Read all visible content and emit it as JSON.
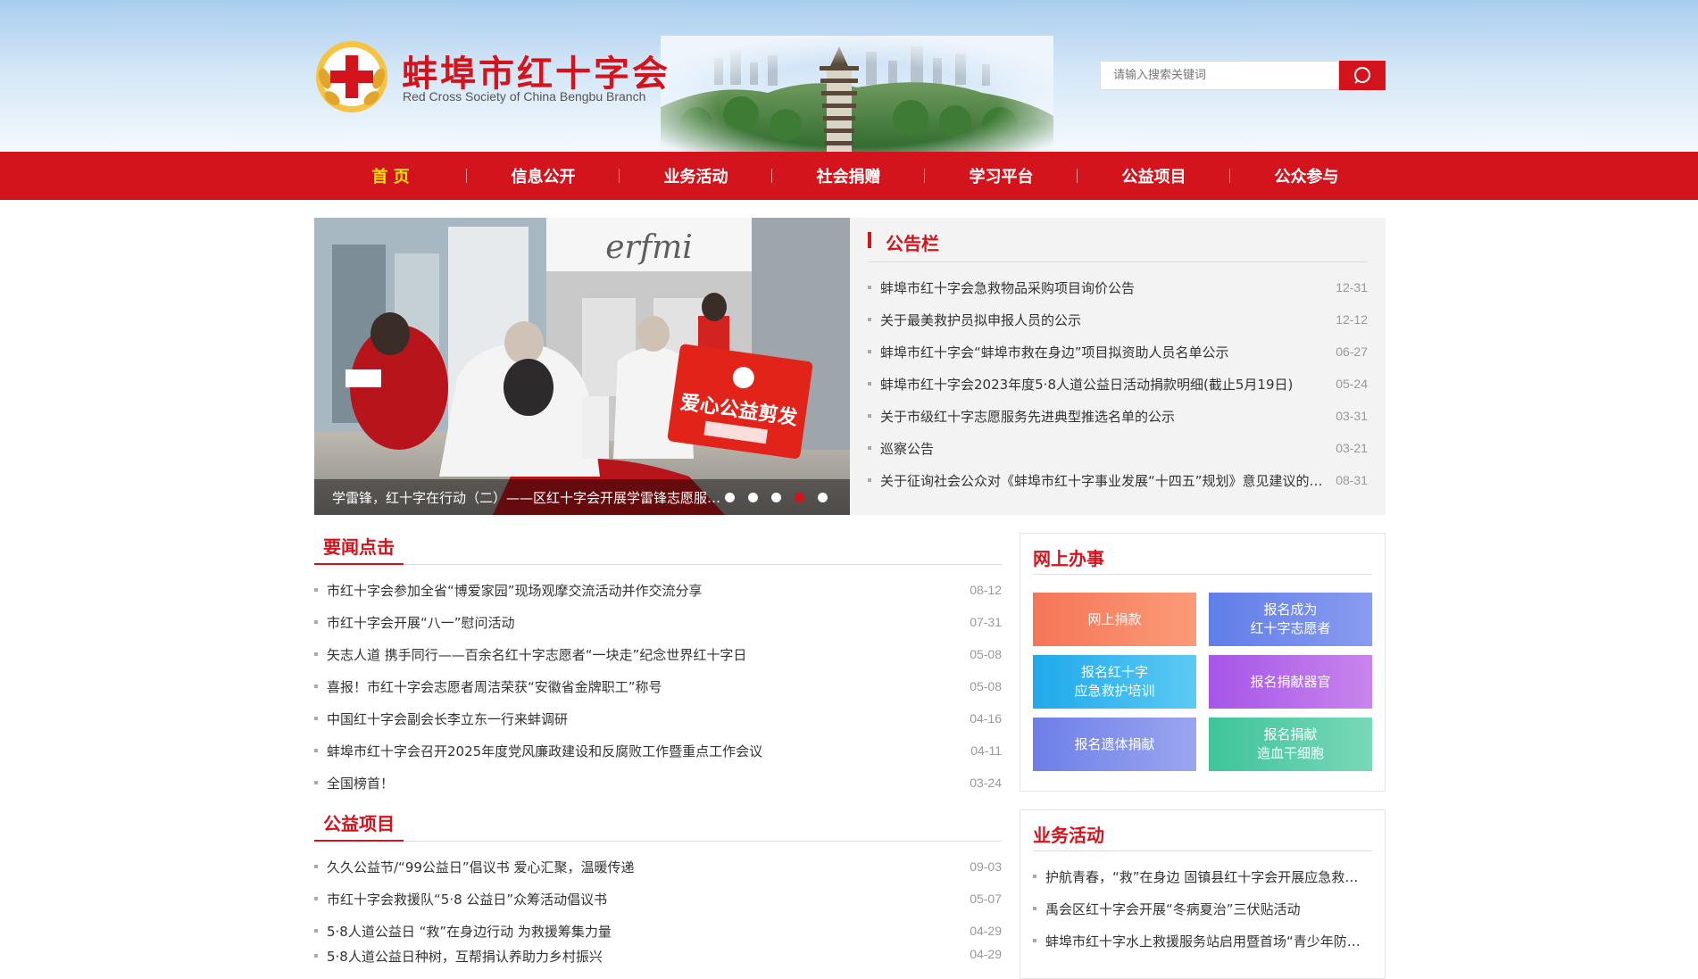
{
  "header": {
    "org_name_cn": "蚌埠市红十字会",
    "org_name_en": "Red Cross Society of China Bengbu Branch",
    "search_placeholder": "请输入搜索关键词"
  },
  "nav": {
    "items": [
      "首 页",
      "信息公开",
      "业务活动",
      "社会捐赠",
      "学习平台",
      "公益项目",
      "公众参与"
    ],
    "active": "首 页"
  },
  "slider": {
    "caption": "学雷锋，红十字在行动（二）——区红十字会开展学雷锋志愿服务活动",
    "storefront_sign": "erfmi",
    "banner_text": "爱心公益剪发",
    "active_dot": 4,
    "dot_count": 5
  },
  "notice_board": {
    "title": "公告栏",
    "items": [
      {
        "text": "蚌埠市红十字会急救物品采购项目询价公告",
        "date": "12-31"
      },
      {
        "text": "关于最美救护员拟申报人员的公示",
        "date": "12-12"
      },
      {
        "text": "蚌埠市红十字会“蚌埠市救在身边”项目拟资助人员名单公示",
        "date": "06-27"
      },
      {
        "text": "蚌埠市红十字会2023年度5·8人道公益日活动捐款明细(截止5月19日)",
        "date": "05-24"
      },
      {
        "text": "关于市级红十字志愿服务先进典型推选名单的公示",
        "date": "03-31"
      },
      {
        "text": "巡察公告",
        "date": "03-21"
      },
      {
        "text": "关于征询社会公众对《蚌埠市红十字事业发展“十四五”规划》意见建议的公告",
        "date": "08-31"
      }
    ]
  },
  "news": {
    "title": "要闻点击",
    "items": [
      {
        "text": "市红十字会参加全省“博爱家园”现场观摩交流活动并作交流分享",
        "date": "08-12"
      },
      {
        "text": "市红十字会开展“八一”慰问活动",
        "date": "07-31"
      },
      {
        "text": "矢志人道 携手同行——百余名红十字志愿者“一块走”纪念世界红十字日",
        "date": "05-08"
      },
      {
        "text": "喜报！市红十字会志愿者周洁荣获“安徽省金牌职工”称号",
        "date": "05-08"
      },
      {
        "text": "中国红十字会副会长李立东一行来蚌调研",
        "date": "04-16"
      },
      {
        "text": "蚌埠市红十字会召开2025年度党风廉政建设和反腐败工作暨重点工作会议",
        "date": "04-11"
      },
      {
        "text": "全国榜首！",
        "date": "03-24"
      }
    ]
  },
  "projects": {
    "title": "公益项目",
    "items": [
      {
        "text": "久久公益节/“99公益日”倡议书 爱心汇聚，温暖传递",
        "date": "09-03"
      },
      {
        "text": "市红十字会救援队“5·8 公益日”众筹活动倡议书",
        "date": "05-07"
      },
      {
        "text": "5·8人道公益日 “救”在身边行动 为救援筹集力量",
        "date": "04-29"
      },
      {
        "text": "5·8人道公益日种树，互帮捐认养助力乡村振兴",
        "date": "04-29"
      }
    ]
  },
  "online_services": {
    "title": "网上办事",
    "buttons": [
      {
        "label": "网上捐款",
        "color": "#f67f63"
      },
      {
        "label": "报名成为\n红十字志愿者",
        "color": "#6f86eb"
      },
      {
        "label": "报名红十字\n应急救护培训",
        "color": "#35b4ee"
      },
      {
        "label": "报名捐献器官",
        "color": "#b366ea"
      },
      {
        "label": "报名遗体捐献",
        "color": "#7f8eea"
      },
      {
        "label": "报名捐献\n造血干细胞",
        "color": "#4ecba3"
      }
    ]
  },
  "business": {
    "title": "业务活动",
    "items": [
      {
        "text": "护航青春，“救”在身边 固镇县红十字会开展应急救护培训进校园活动"
      },
      {
        "text": "禹会区红十字会开展“冬病夏治”三伏贴活动"
      },
      {
        "text": "蚌埠市红十字水上救援服务站启用暨首场“青少年防溺水”活动"
      }
    ]
  },
  "colors": {
    "brand_red": "#d4141c",
    "nav_active": "#ffe400"
  }
}
